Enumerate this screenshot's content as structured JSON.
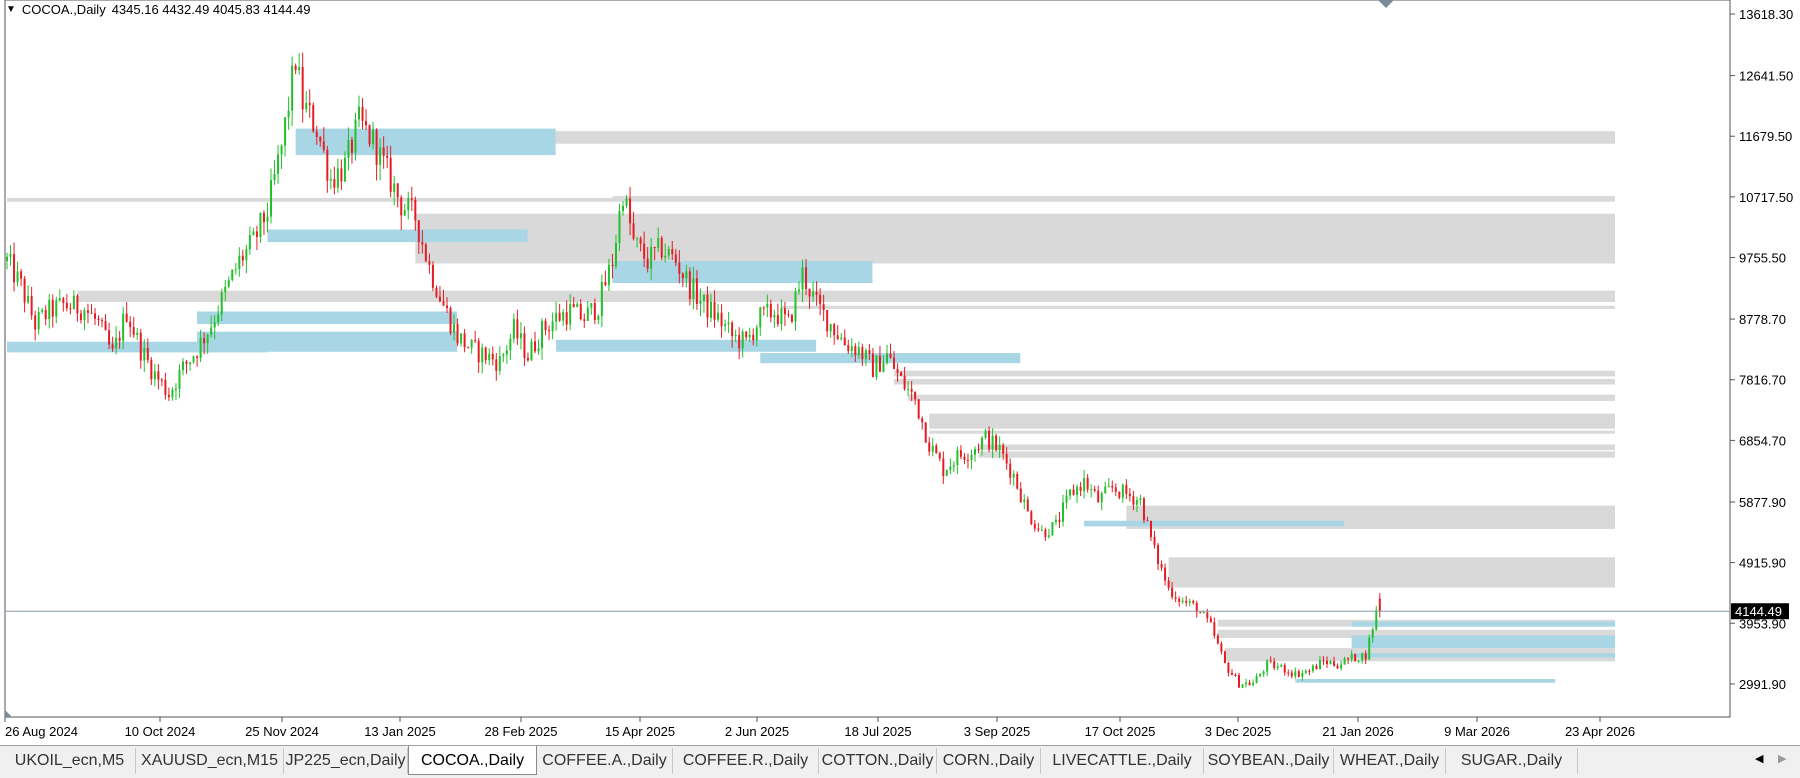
{
  "header": {
    "symbol_tf": "COCOA.,Daily",
    "ohlc": "4345.16 4432.49 4045.83 4144.49"
  },
  "price_label": "4144.49",
  "tabs": [
    {
      "label": "UKOIL_ecn,M5",
      "active": false
    },
    {
      "label": "XAUUSD_ecn,M15",
      "active": false
    },
    {
      "label": "JP225_ecn,Daily",
      "active": false
    },
    {
      "label": "COCOA.,Daily",
      "active": true
    },
    {
      "label": "COFFEE.A.,Daily",
      "active": false
    },
    {
      "label": "COFFEE.R.,Daily",
      "active": false
    },
    {
      "label": "COTTON.,Daily",
      "active": false
    },
    {
      "label": "CORN.,Daily",
      "active": false
    },
    {
      "label": "LIVECATTLE.,Daily",
      "active": false
    },
    {
      "label": "SOYBEAN.,Daily",
      "active": false
    },
    {
      "label": "WHEAT.,Daily",
      "active": false
    },
    {
      "label": "SUGAR.,Daily",
      "active": false
    }
  ],
  "colors": {
    "bull": "#22c02c",
    "bear": "#e51c23",
    "supply_zone": "#d9d9d9",
    "demand_zone": "#a9d6e5",
    "price_line": "#8a9aa8"
  },
  "chart_data": {
    "type": "candlestick",
    "symbol": "COCOA.",
    "timeframe": "Daily",
    "y_ticks": [
      13618.3,
      12641.5,
      11679.5,
      10717.5,
      9755.5,
      8778.7,
      7816.7,
      6854.7,
      5877.9,
      4915.9,
      3953.9,
      2991.9
    ],
    "y_tick_labels": [
      "13618.30",
      "12641.50",
      "11679.50",
      "10717.50",
      "9755.50",
      "8778.70",
      "7816.70",
      "6854.70",
      "5877.90",
      "4915.90",
      "3953.90",
      "2991.90"
    ],
    "ylim": [
      2460,
      13800
    ],
    "x_tick_labels": [
      "26 Aug 2024",
      "10 Oct 2024",
      "25 Nov 2024",
      "13 Jan 2025",
      "28 Feb 2025",
      "15 Apr 2025",
      "2 Jun 2025",
      "18 Jul 2025",
      "3 Sep 2025",
      "17 Oct 2025",
      "3 Dec 2025",
      "21 Jan 2026",
      "9 Mar 2026",
      "23 Apr 2026"
    ],
    "last_close": 4144.49,
    "last_bar": {
      "open": 4345.16,
      "high": 4432.49,
      "low": 4045.83,
      "close": 4144.49
    },
    "trend_anchors": [
      [
        0,
        9700
      ],
      [
        4,
        9300
      ],
      [
        8,
        8700
      ],
      [
        12,
        8900
      ],
      [
        16,
        9000
      ],
      [
        22,
        8950
      ],
      [
        26,
        8700
      ],
      [
        30,
        8200
      ],
      [
        34,
        8900
      ],
      [
        38,
        8300
      ],
      [
        42,
        7900
      ],
      [
        46,
        7600
      ],
      [
        50,
        8000
      ],
      [
        54,
        8300
      ],
      [
        58,
        8700
      ],
      [
        62,
        9200
      ],
      [
        66,
        9700
      ],
      [
        70,
        10000
      ],
      [
        74,
        10500
      ],
      [
        78,
        11500
      ],
      [
        82,
        12900
      ],
      [
        84,
        12200
      ],
      [
        88,
        11800
      ],
      [
        92,
        11000
      ],
      [
        96,
        11200
      ],
      [
        100,
        11900
      ],
      [
        104,
        11600
      ],
      [
        108,
        11100
      ],
      [
        112,
        10600
      ],
      [
        116,
        10400
      ],
      [
        120,
        9600
      ],
      [
        124,
        9000
      ],
      [
        128,
        8500
      ],
      [
        132,
        8300
      ],
      [
        136,
        8200
      ],
      [
        140,
        8100
      ],
      [
        144,
        8600
      ],
      [
        148,
        8200
      ],
      [
        152,
        8600
      ],
      [
        156,
        8800
      ],
      [
        160,
        8900
      ],
      [
        164,
        8800
      ],
      [
        168,
        9000
      ],
      [
        172,
        9700
      ],
      [
        175,
        10800
      ],
      [
        178,
        10000
      ],
      [
        182,
        9700
      ],
      [
        186,
        9900
      ],
      [
        190,
        9700
      ],
      [
        194,
        9300
      ],
      [
        198,
        9000
      ],
      [
        202,
        8800
      ],
      [
        206,
        8500
      ],
      [
        210,
        8400
      ],
      [
        214,
        8800
      ],
      [
        218,
        8900
      ],
      [
        222,
        8700
      ],
      [
        226,
        9500
      ],
      [
        230,
        9000
      ],
      [
        234,
        8700
      ],
      [
        238,
        8400
      ],
      [
        242,
        8300
      ],
      [
        246,
        8000
      ],
      [
        250,
        8200
      ],
      [
        254,
        7800
      ],
      [
        258,
        7500
      ],
      [
        262,
        6800
      ],
      [
        266,
        6400
      ],
      [
        270,
        6600
      ],
      [
        274,
        6700
      ],
      [
        278,
        6900
      ],
      [
        282,
        6700
      ],
      [
        286,
        6300
      ],
      [
        290,
        5700
      ],
      [
        294,
        5400
      ],
      [
        298,
        5500
      ],
      [
        302,
        6000
      ],
      [
        306,
        6200
      ],
      [
        310,
        5900
      ],
      [
        314,
        6100
      ],
      [
        318,
        6000
      ],
      [
        322,
        5900
      ],
      [
        326,
        5100
      ],
      [
        330,
        4500
      ],
      [
        334,
        4300
      ],
      [
        338,
        4200
      ],
      [
        342,
        3900
      ],
      [
        346,
        3300
      ],
      [
        350,
        3000
      ],
      [
        354,
        3000
      ],
      [
        358,
        3300
      ],
      [
        362,
        3250
      ],
      [
        366,
        3150
      ],
      [
        370,
        3200
      ],
      [
        374,
        3350
      ],
      [
        378,
        3300
      ],
      [
        382,
        3400
      ],
      [
        386,
        3450
      ],
      [
        390,
        4350
      ]
    ],
    "supply_zones": [
      {
        "from_bar": 100,
        "y_low": 11560,
        "y_high": 11760
      },
      {
        "from_bar": 0,
        "y_low": 10640,
        "y_high": 10700
      },
      {
        "from_bar": 172,
        "y_low": 10660,
        "y_high": 10730
      },
      {
        "from_bar": 116,
        "y_low": 9660,
        "y_high": 10450
      },
      {
        "from_bar": 20,
        "y_low": 9050,
        "y_high": 9230
      },
      {
        "from_bar": 220,
        "y_low": 8940,
        "y_high": 8990
      },
      {
        "from_bar": 252,
        "y_low": 7870,
        "y_high": 7960
      },
      {
        "from_bar": 252,
        "y_low": 7740,
        "y_high": 7830
      },
      {
        "from_bar": 256,
        "y_low": 7480,
        "y_high": 7580
      },
      {
        "from_bar": 262,
        "y_low": 7040,
        "y_high": 7280
      },
      {
        "from_bar": 262,
        "y_low": 6960,
        "y_high": 7010
      },
      {
        "from_bar": 276,
        "y_low": 6700,
        "y_high": 6790
      },
      {
        "from_bar": 276,
        "y_low": 6580,
        "y_high": 6680
      },
      {
        "from_bar": 318,
        "y_low": 5450,
        "y_high": 5820
      },
      {
        "from_bar": 330,
        "y_low": 4520,
        "y_high": 5000
      },
      {
        "from_bar": 344,
        "y_low": 3900,
        "y_high": 4010
      },
      {
        "from_bar": 344,
        "y_low": 3720,
        "y_high": 3850
      },
      {
        "from_bar": 346,
        "y_low": 3350,
        "y_high": 3560
      }
    ],
    "demand_zones": [
      {
        "from_bar": 0,
        "y_low": 8250,
        "y_high": 8420
      },
      {
        "from_bar": 54,
        "y_low": 8700,
        "y_high": 8900
      },
      {
        "from_bar": 54,
        "y_low": 8260,
        "y_high": 8580
      },
      {
        "from_bar": 74,
        "y_low": 10000,
        "y_high": 10200
      },
      {
        "from_bar": 82,
        "y_low": 11380,
        "y_high": 11800
      },
      {
        "from_bar": 156,
        "y_low": 8260,
        "y_high": 8450
      },
      {
        "from_bar": 172,
        "y_low": 9350,
        "y_high": 9700
      },
      {
        "from_bar": 214,
        "y_low": 8080,
        "y_high": 8240
      },
      {
        "from_bar": 306,
        "y_low": 5490,
        "y_high": 5580
      },
      {
        "from_bar": 382,
        "y_low": 3900,
        "y_high": 3980
      },
      {
        "from_bar": 382,
        "y_low": 3560,
        "y_high": 3760
      },
      {
        "from_bar": 382,
        "y_low": 3410,
        "y_high": 3480
      },
      {
        "from_bar": 366,
        "y_low": 3010,
        "y_high": 3070
      }
    ],
    "grid": false,
    "legend": "none"
  }
}
